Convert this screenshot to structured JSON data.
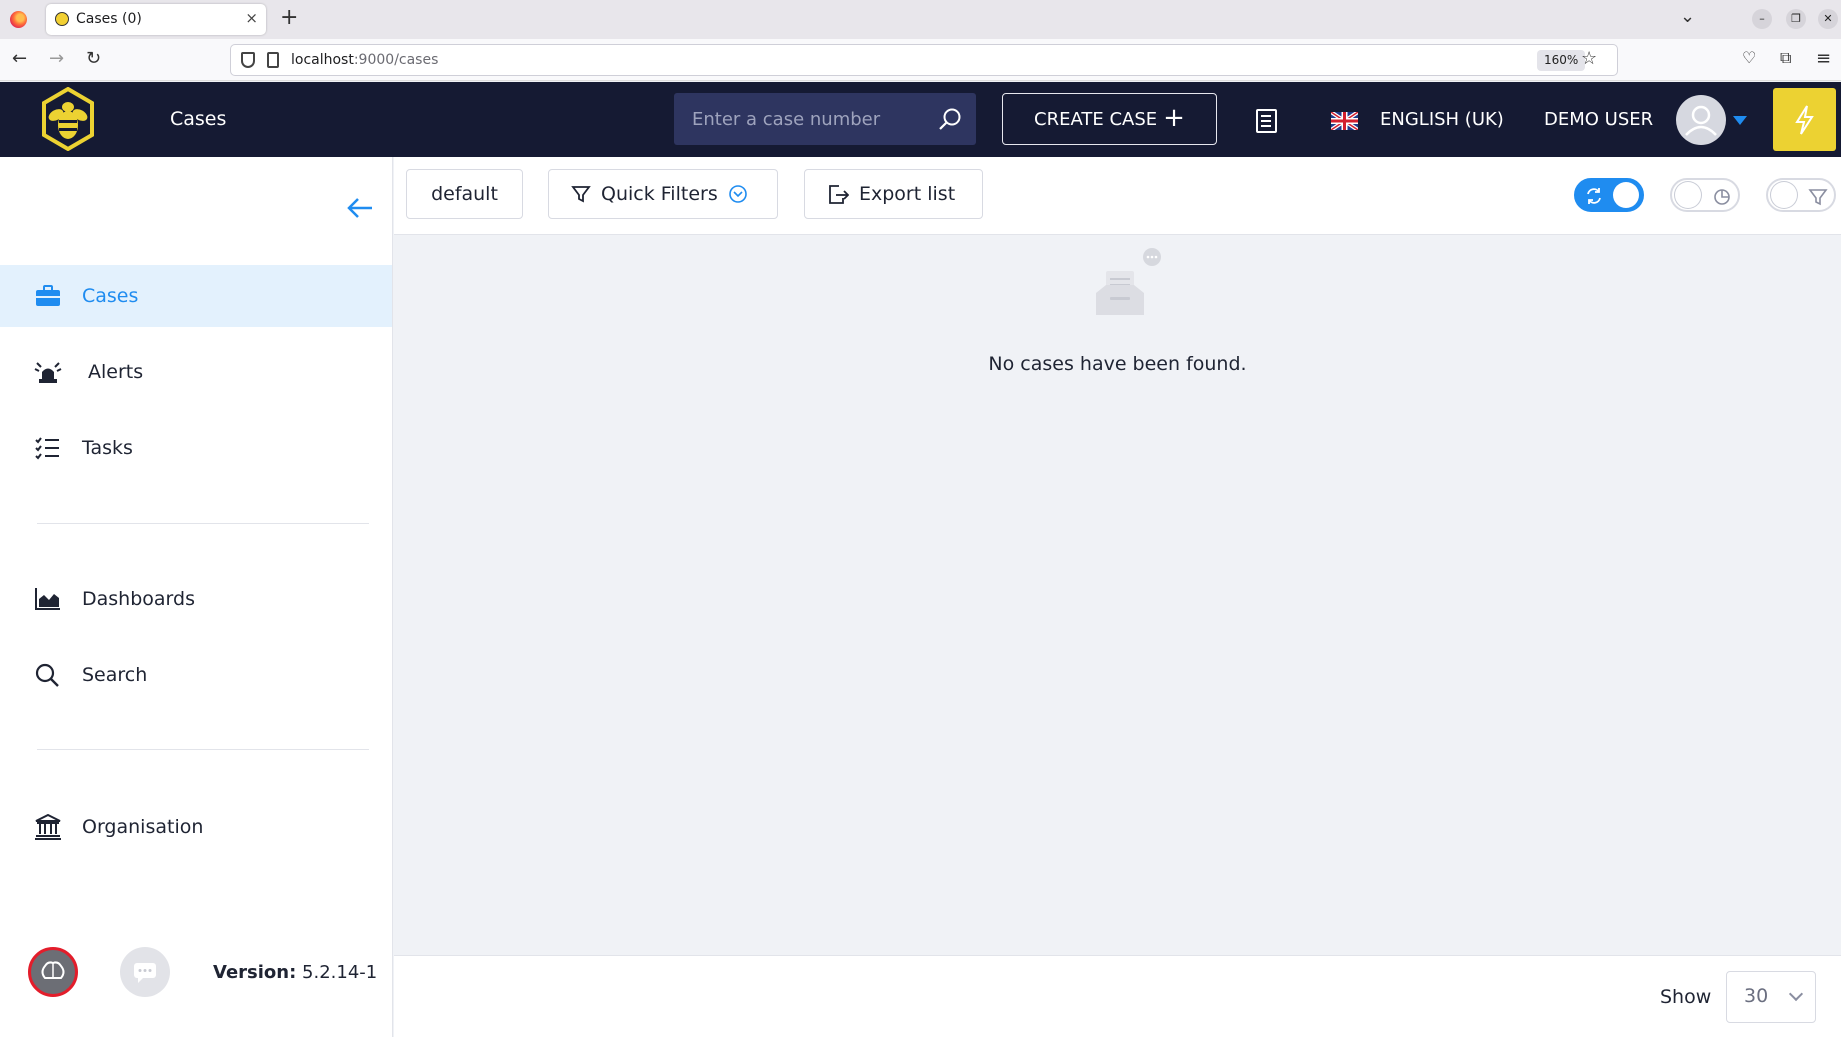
{
  "browser": {
    "tab_title": "Cases (0)",
    "tab_close": "×",
    "new_tab": "+",
    "url_host": "localhost",
    "url_path": ":9000/cases",
    "zoom": "160%"
  },
  "header": {
    "title": "Cases",
    "search_placeholder": "Enter a case number",
    "create_label": "CREATE CASE",
    "create_icon": "+",
    "language": "ENGLISH (UK)",
    "user": "DEMO USER",
    "brand_color": "#151a33",
    "accent_color": "#ecd232"
  },
  "sidebar": {
    "items": [
      {
        "label": "Cases",
        "icon": "briefcase-icon",
        "active": true
      },
      {
        "label": "Alerts",
        "icon": "siren-icon"
      },
      {
        "label": "Tasks",
        "icon": "tasklist-icon"
      },
      {
        "label": "Dashboards",
        "icon": "chart-area-icon"
      },
      {
        "label": "Search",
        "icon": "search-icon"
      },
      {
        "label": "Organisation",
        "icon": "institution-icon"
      }
    ],
    "version_label": "Version:",
    "version_value": "5.2.14-1"
  },
  "toolbar": {
    "default_label": "default",
    "quick_filters_label": "Quick Filters",
    "export_label": "Export list",
    "toggles": {
      "auto_refresh": true,
      "stats": false,
      "filters": false
    }
  },
  "content": {
    "empty_message": "No cases have been found."
  },
  "footer": {
    "show_label": "Show",
    "page_size": "30"
  }
}
